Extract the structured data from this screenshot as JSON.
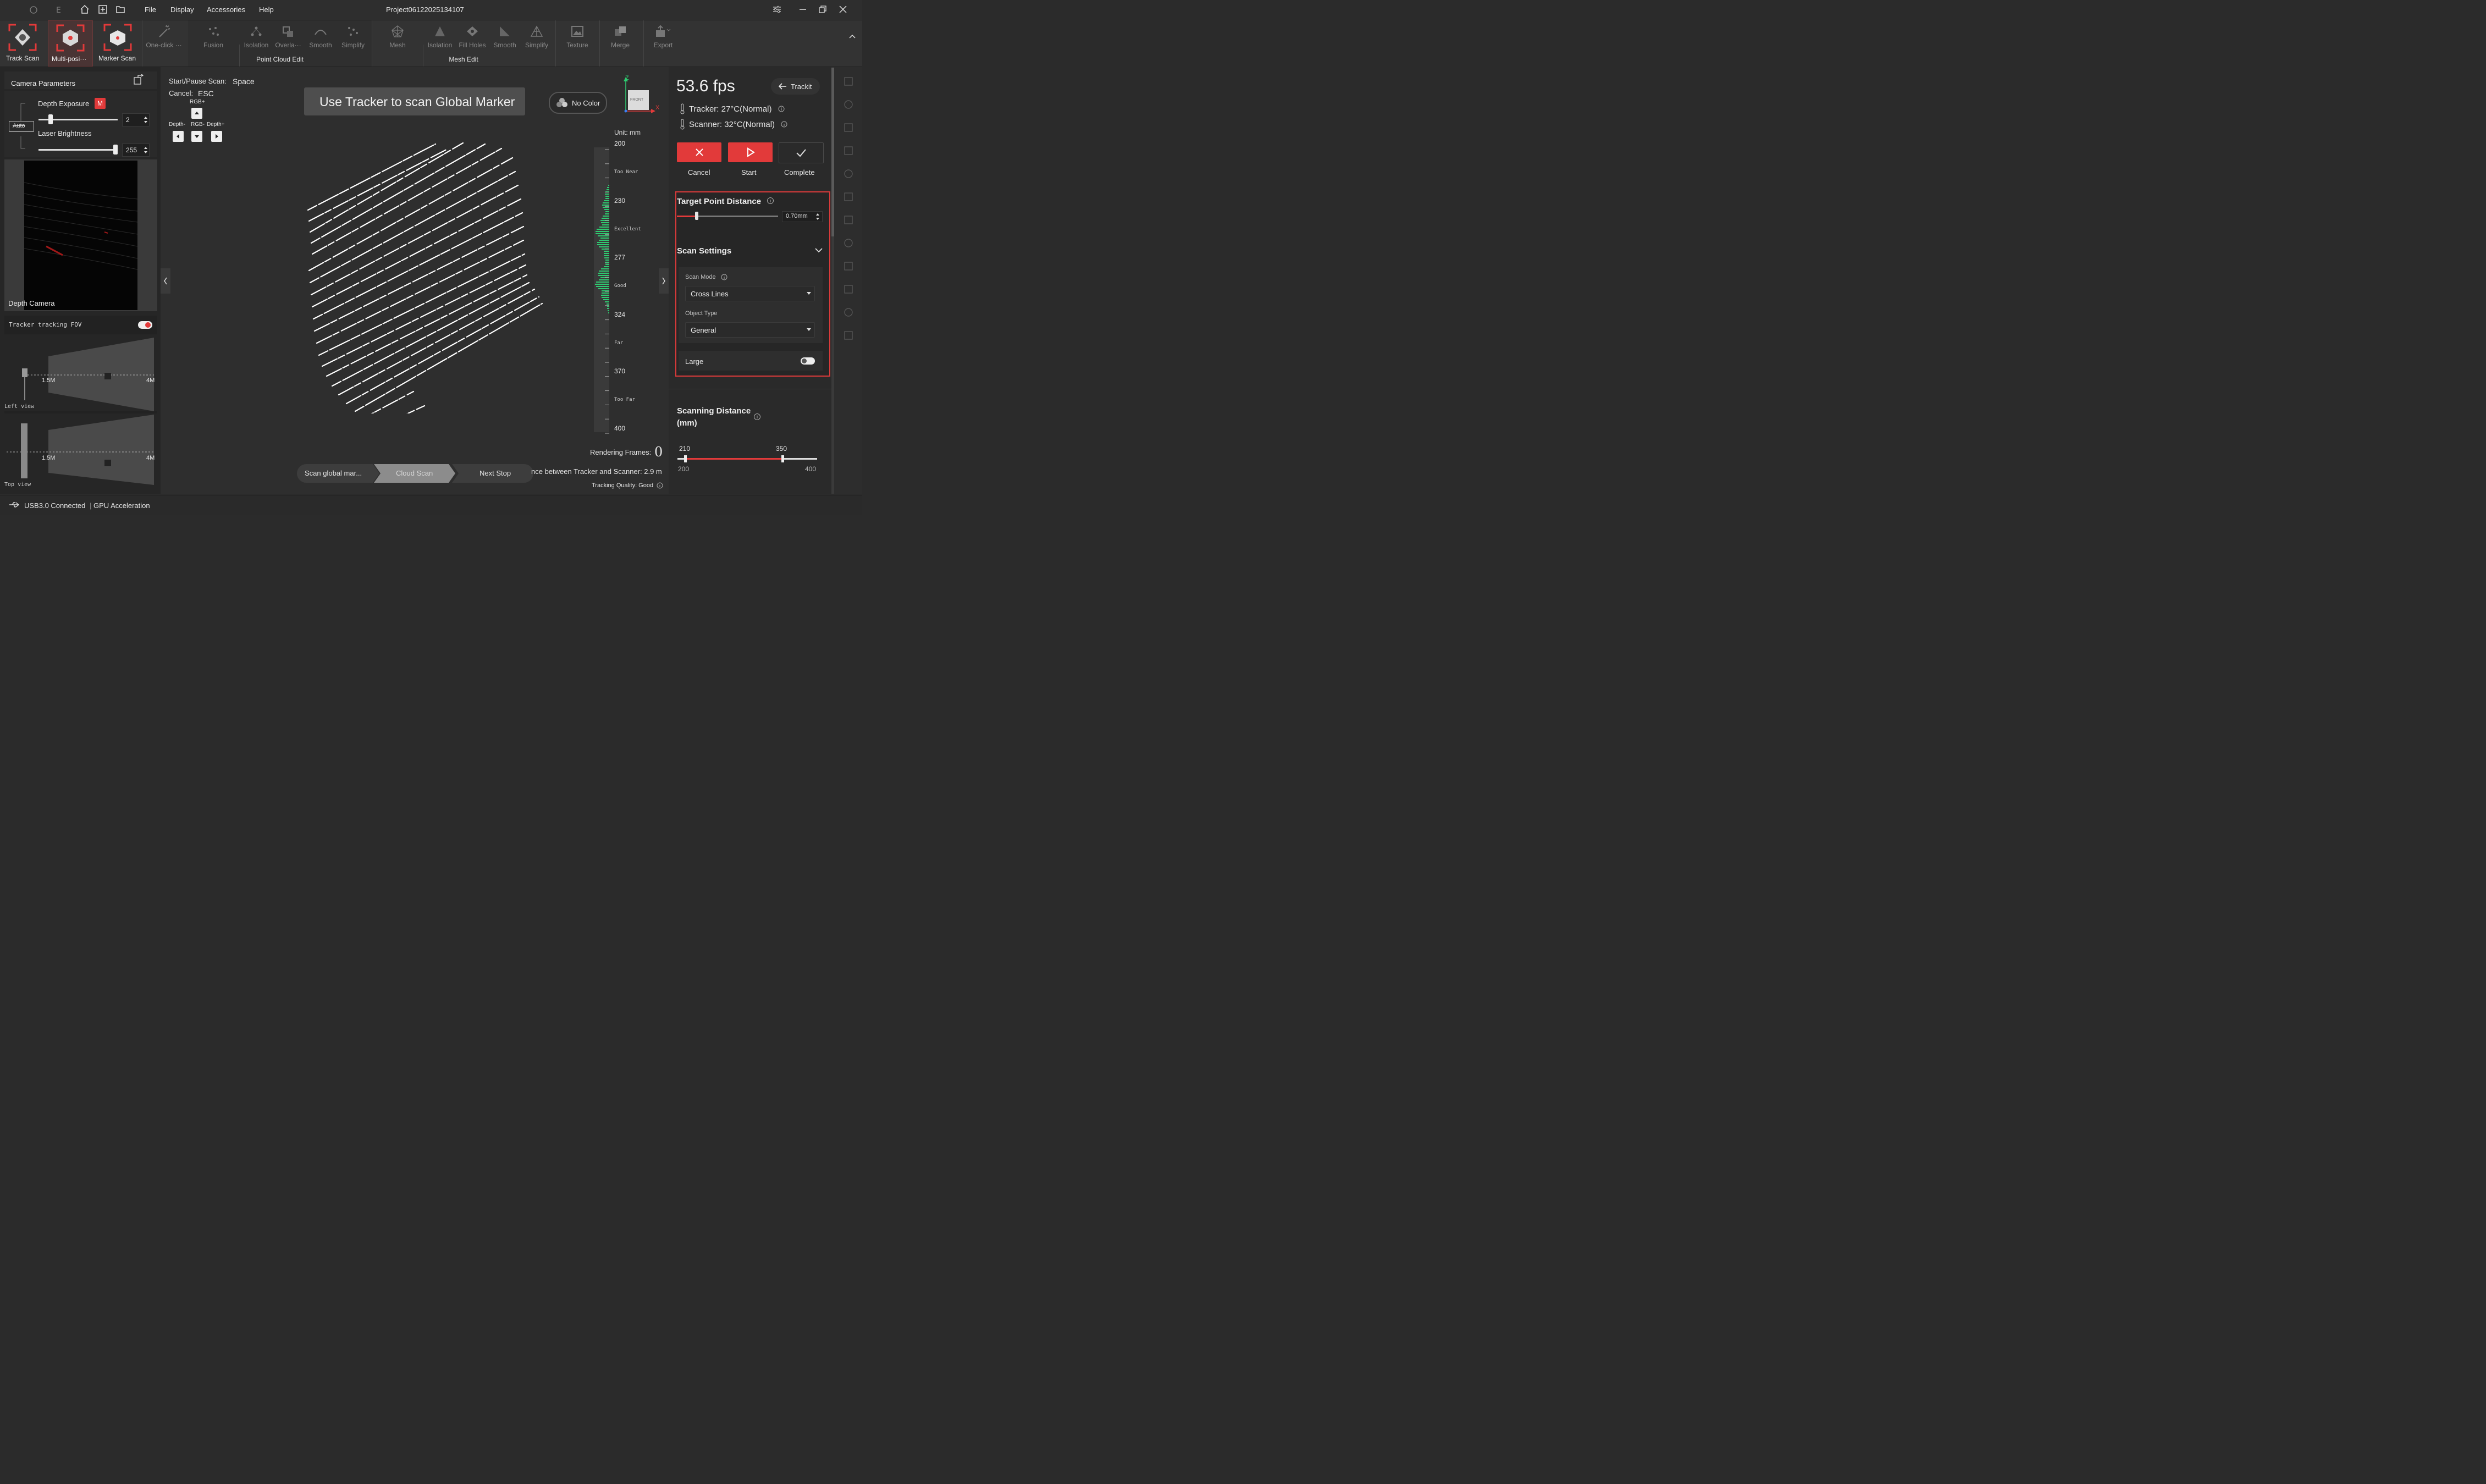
{
  "title": "Project06122025134107",
  "menu": [
    "File",
    "Display",
    "Accessories",
    "Help"
  ],
  "ribbon": {
    "modes": [
      "Track Scan",
      "Multi-posi···",
      "Marker Scan"
    ],
    "tools": {
      "oneclick": "One-click ···",
      "fusion": "Fusion",
      "pc_isolation": "Isolation",
      "overlap": "Overla···",
      "pc_smooth": "Smooth",
      "pc_simplify": "Simplify",
      "mesh": "Mesh",
      "m_isolation": "Isolation",
      "fill_holes": "Fill Holes",
      "m_smooth": "Smooth",
      "m_simplify": "Simplify",
      "texture": "Texture",
      "merge": "Merge",
      "export": "Export"
    },
    "group_pc": "Point Cloud Edit",
    "group_mesh": "Mesh Edit"
  },
  "camera": {
    "title": "Camera Parameters",
    "depth_exposure": "Depth Exposure",
    "mode_badge": "M",
    "auto": "Auto",
    "exposure_value": "2",
    "laser_brightness": "Laser Brightness",
    "laser_value": "255",
    "depth_camera": "Depth Camera",
    "exposure_level": 0.13,
    "laser_level": 1.0
  },
  "fov": {
    "title": "Tracker tracking FOV",
    "left_view": "Left view",
    "top_view": "Top view",
    "near": "1.5M",
    "far": "4M"
  },
  "viewport": {
    "shortcut_scan_label": "Start/Pause Scan:",
    "shortcut_scan_key": "Space",
    "shortcut_cancel_label": "Cancel:",
    "shortcut_cancel_key": "ESC",
    "rgb_plus": "RGB+",
    "depth_minus": "Depth-",
    "rgb_minus": "RGB-",
    "depth_plus": "Depth+",
    "banner": "Use Tracker to scan Global Marker",
    "no_color": "No Color",
    "axis_z": "Z",
    "axis_x": "X",
    "cube_face": "FRONT",
    "unit": "Unit: mm",
    "scale_values": [
      "200",
      "230",
      "277",
      "324",
      "370",
      "400"
    ],
    "scale_labels": [
      "Too Near",
      "Excellent",
      "Good",
      "Far",
      "Too Far"
    ],
    "rendering_frames_label": "Rendering Frames:",
    "rendering_frames_value": "0",
    "distance_text": "nce between Tracker and Scanner: 2.9 m",
    "tracking_quality": "Tracking Quality: Good",
    "steps": [
      "Scan global mar...",
      "Cloud Scan",
      "Next Stop"
    ]
  },
  "right": {
    "fps": "53.6 fps",
    "trackit": "Trackit",
    "tracker_temp": "Tracker: 27°C(Normal)",
    "scanner_temp": "Scanner: 32°C(Normal)",
    "cancel": "Cancel",
    "start": "Start",
    "complete": "Complete",
    "target_distance_title": "Target Point Distance",
    "target_distance_value": "0.70mm",
    "target_distance_level": 0.2,
    "scan_settings": "Scan Settings",
    "scan_mode_label": "Scan Mode",
    "scan_mode_value": "Cross Lines",
    "object_type_label": "Object Type",
    "object_type_value": "General",
    "large_label": "Large",
    "large_on": false,
    "scanning_distance_title": "Scanning Distance",
    "scanning_distance_unit": "(mm)",
    "sd_min_sel": "210",
    "sd_max_sel": "350",
    "sd_min": "200",
    "sd_max": "400"
  },
  "status": {
    "usb": "USB3.0 Connected",
    "gpu": "GPU Acceleration"
  },
  "colors": {
    "accent_red": "#e23a3a",
    "highlight_border": "#d93a3a",
    "histogram_green": "#2ecc71"
  }
}
